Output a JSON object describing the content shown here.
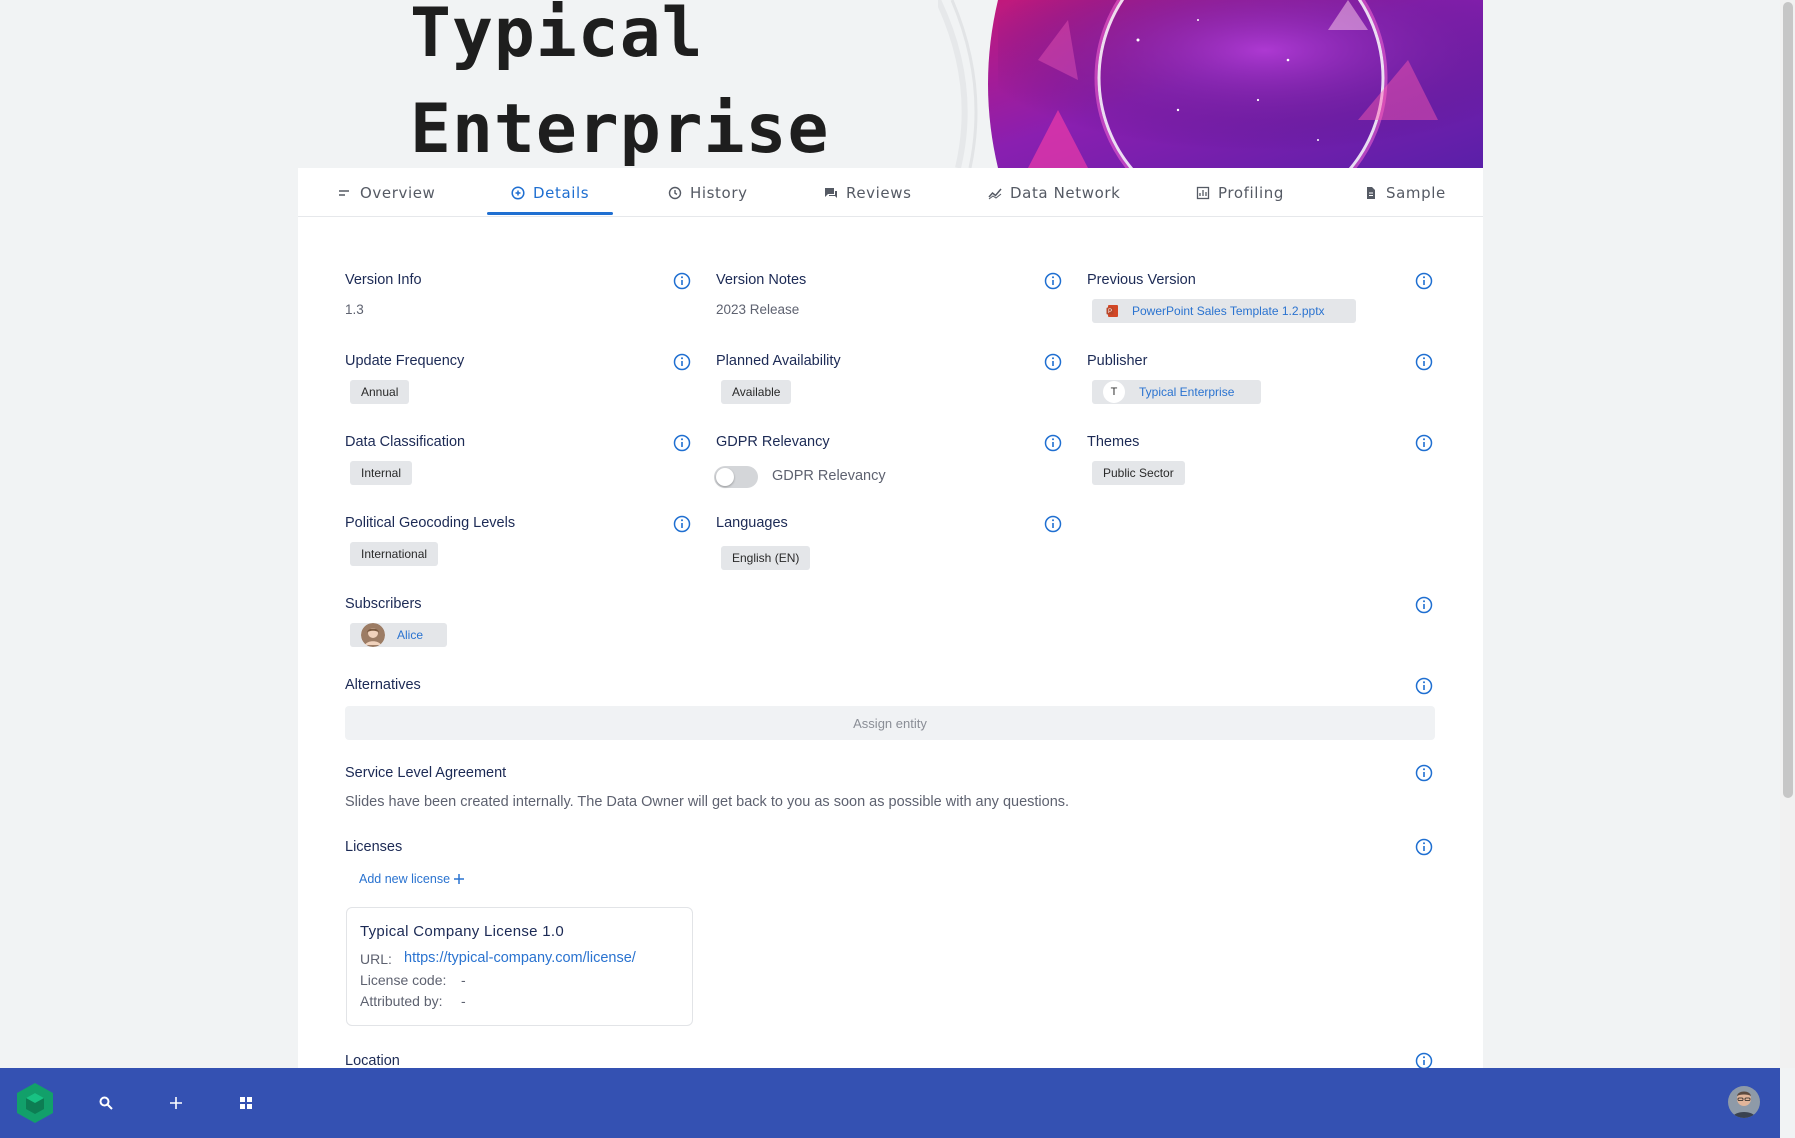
{
  "hero": {
    "title_line1": "Typical",
    "title_line2": "Enterprise"
  },
  "tabs": [
    {
      "label": "Overview",
      "icon": "lines-icon"
    },
    {
      "label": "Details",
      "icon": "plus-circle-icon"
    },
    {
      "label": "History",
      "icon": "history-icon"
    },
    {
      "label": "Reviews",
      "icon": "chat-icon"
    },
    {
      "label": "Data Network",
      "icon": "network-icon"
    },
    {
      "label": "Profiling",
      "icon": "profiling-icon"
    },
    {
      "label": "Sample",
      "icon": "document-icon"
    }
  ],
  "active_tab": "Details",
  "fields": {
    "version_info": {
      "label": "Version Info",
      "value": "1.3"
    },
    "version_notes": {
      "label": "Version Notes",
      "value": "2023 Release"
    },
    "previous_version": {
      "label": "Previous Version",
      "value": "PowerPoint Sales Template 1.2.pptx"
    },
    "update_frequency": {
      "label": "Update Frequency",
      "value": "Annual"
    },
    "planned_availability": {
      "label": "Planned Availability",
      "value": "Available"
    },
    "publisher": {
      "label": "Publisher",
      "initial": "T",
      "value": "Typical Enterprise"
    },
    "data_classification": {
      "label": "Data Classification",
      "value": "Internal"
    },
    "gdpr_relevancy": {
      "label": "GDPR Relevancy",
      "toggle_label": "GDPR Relevancy",
      "enabled": false
    },
    "themes": {
      "label": "Themes",
      "value": "Public Sector"
    },
    "political_geocoding": {
      "label": "Political Geocoding Levels",
      "value": "International"
    },
    "languages": {
      "label": "Languages",
      "value": "English (EN)"
    },
    "subscribers": {
      "label": "Subscribers",
      "value": "Alice"
    },
    "alternatives": {
      "label": "Alternatives",
      "placeholder": "Assign entity"
    },
    "sla": {
      "label": "Service Level Agreement",
      "value": "Slides have been created internally. The Data Owner will get back to you as soon as possible with any questions."
    },
    "licenses": {
      "label": "Licenses",
      "add_label": "Add new license",
      "card": {
        "title": "Typical Company License 1.0",
        "url_label": "URL:",
        "url": "https://typical-company.com/license/",
        "code_label": "License code:",
        "code": "-",
        "attributed_label": "Attributed by:",
        "attributed": "-"
      }
    },
    "location": {
      "label": "Location"
    }
  },
  "colors": {
    "accent": "#1f6fd1",
    "bottom_bar": "#3451b2",
    "label": "#1c2a55"
  },
  "bottom_bar": {
    "icons": [
      "logo-icon",
      "search-icon",
      "plus-icon",
      "grid-icon",
      "user-avatar"
    ]
  }
}
